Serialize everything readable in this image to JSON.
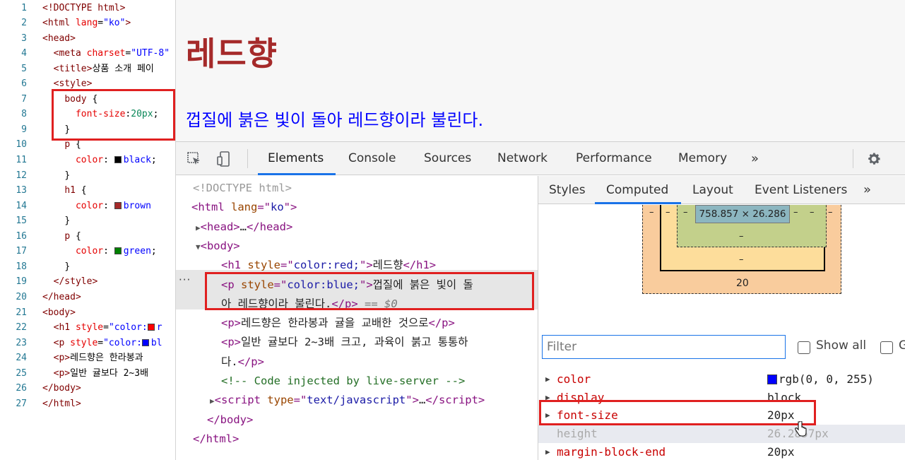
{
  "editor": {
    "lines": [
      {
        "n": "1",
        "html": "<span class='c-tag'>&lt;!DOCTYPE html&gt;</span>"
      },
      {
        "n": "2",
        "html": "<span class='c-tag'>&lt;html </span><span class='c-attr'>lang</span><span class='c-txt'>=</span><span class='c-str'>\"ko\"</span><span class='c-tag'>&gt;</span>"
      },
      {
        "n": "3",
        "html": "<span class='c-tag'>&lt;head&gt;</span>"
      },
      {
        "n": "4",
        "html": "  <span class='c-tag'>&lt;meta </span><span class='c-attr'>charset</span><span class='c-txt'>=</span><span class='c-str'>\"UTF-8\"</span>"
      },
      {
        "n": "5",
        "html": "  <span class='c-tag'>&lt;title&gt;</span><span class='c-txt'>상품 소개 페이</span>"
      },
      {
        "n": "6",
        "html": "  <span class='c-tag'>&lt;style&gt;</span>"
      },
      {
        "n": "7",
        "html": "    <span class='c-sel'>body</span> <span class='c-txt'>{</span>"
      },
      {
        "n": "8",
        "html": "      <span class='c-prop'>font-size</span><span class='c-txt'>:</span><span class='c-num'>20px</span><span class='c-txt'>;</span>"
      },
      {
        "n": "9",
        "html": "    <span class='c-txt'>}</span>"
      },
      {
        "n": "10",
        "html": "    <span class='c-sel'>p</span> <span class='c-txt'>{</span>"
      },
      {
        "n": "11",
        "html": "      <span class='c-prop'>color</span><span class='c-txt'>: </span><span class='swatch' style='background:#000'></span><span class='c-str'>black</span><span class='c-txt'>;</span>"
      },
      {
        "n": "12",
        "html": "    <span class='c-txt'>}</span>"
      },
      {
        "n": "13",
        "html": "    <span class='c-sel'>h1</span> <span class='c-txt'>{</span>"
      },
      {
        "n": "14",
        "html": "      <span class='c-prop'>color</span><span class='c-txt'>: </span><span class='swatch' style='background:#a52a2a'></span><span class='c-str'>brown</span>"
      },
      {
        "n": "15",
        "html": "    <span class='c-txt'>}</span>"
      },
      {
        "n": "16",
        "html": "    <span class='c-sel'>p</span> <span class='c-txt'>{</span>"
      },
      {
        "n": "17",
        "html": "      <span class='c-prop'>color</span><span class='c-txt'>: </span><span class='swatch' style='background:#008000'></span><span class='c-str'>green</span><span class='c-txt'>;</span>"
      },
      {
        "n": "18",
        "html": "    <span class='c-txt'>}</span>"
      },
      {
        "n": "19",
        "html": "  <span class='c-tag'>&lt;/style&gt;</span>"
      },
      {
        "n": "20",
        "html": "<span class='c-tag'>&lt;/head&gt;</span>"
      },
      {
        "n": "21",
        "html": "<span class='c-tag'>&lt;body&gt;</span>"
      },
      {
        "n": "22",
        "html": "  <span class='c-tag'>&lt;h1 </span><span class='c-attr'>style</span><span class='c-txt'>=</span><span class='c-str'>\"color:</span><span class='swatch' style='background:#ff0000'></span><span class='c-str'>r</span>"
      },
      {
        "n": "23",
        "html": "  <span class='c-tag'>&lt;p </span><span class='c-attr'>style</span><span class='c-txt'>=</span><span class='c-str'>\"color:</span><span class='swatch' style='background:#0000ff'></span><span class='c-str'>bl</span>"
      },
      {
        "n": "24",
        "html": "  <span class='c-tag'>&lt;p&gt;</span><span class='c-txt'>레드향은 한라봉과 </span>"
      },
      {
        "n": "25",
        "html": "  <span class='c-tag'>&lt;p&gt;</span><span class='c-txt'>일반 귤보다 2~3배 </span>"
      },
      {
        "n": "26",
        "html": "<span class='c-tag'>&lt;/body&gt;</span>"
      },
      {
        "n": "27",
        "html": "<span class='c-tag'>&lt;/html&gt;</span>"
      }
    ]
  },
  "rendered_page": {
    "h1": "레드향",
    "p": "껍질에 붉은 빛이 돌아 레드향이라 불린다."
  },
  "devtools": {
    "tabs": [
      "Elements",
      "Console",
      "Sources",
      "Network",
      "Performance",
      "Memory"
    ],
    "more_tabs": "»",
    "gear_icon": "gear-icon",
    "dom": [
      {
        "html": "<span class='d-doctype'>&lt;!DOCTYPE html&gt;</span>"
      },
      {
        "html": "<span class='d-tag'>&lt;html </span><span class='d-attr'>lang</span><span class='d-tag'>=\"</span><span class='d-val'>ko</span><span class='d-tag'>\"&gt;</span>"
      },
      {
        "html": "<span class='d-tri'>▶</span><span class='d-tag'>&lt;head&gt;</span><span class='d-text'>…</span><span class='d-tag'>&lt;/head&gt;</span>"
      },
      {
        "html": "<span class='d-tri'>▼</span><span class='d-tag'>&lt;body&gt;</span>"
      },
      {
        "html": "<span class='d-tag'>&lt;h1 </span><span class='d-attr'>style</span><span class='d-tag'>=\"</span><span class='d-val'>color:red;</span><span class='d-tag'>\"&gt;</span><span class='d-text'>레드향</span><span class='d-tag'>&lt;/h1&gt;</span>"
      },
      {
        "html": "<span class='d-tag'>&lt;p </span><span class='d-attr'>style</span><span class='d-tag'>=\"</span><span class='d-val'>color:blue;</span><span class='d-tag'>\"&gt;</span><span class='d-text'>껍질에 붉은 빛이 돌</span>"
      },
      {
        "html": "<span class='d-text'>아 레드향이라 불린다.</span><span class='d-tag'>&lt;/p&gt;</span><span class='d-meta'> == $0</span>"
      },
      {
        "html": "<span class='d-tag'>&lt;p&gt;</span><span class='d-text'>레드향은 한라봉과 귤을 교배한 것으로</span><span class='d-tag'>&lt;/p&gt;</span>"
      },
      {
        "html": "<span class='d-tag'>&lt;p&gt;</span><span class='d-text'>일반 귤보다 2~3배 크고, 과육이 붉고 통통하</span>"
      },
      {
        "html": "<span class='d-text'>다.</span><span class='d-tag'>&lt;/p&gt;</span>"
      },
      {
        "html": "<span class='d-comment'>&lt;!-- Code injected by live-server --&gt;</span>"
      },
      {
        "html": "<span class='d-tri'>▶</span><span class='d-tag'>&lt;script </span><span class='d-attr'>type</span><span class='d-tag'>=\"</span><span class='d-val'>text/javascript</span><span class='d-tag'>\"&gt;</span><span class='d-text'>…</span><span class='d-tag'>&lt;/script&gt;</span>"
      },
      {
        "html": "<span class='d-tag'>&lt;/body&gt;</span>"
      },
      {
        "html": "<span class='d-tag'>&lt;/html&gt;</span>"
      }
    ],
    "dom_dots": "···",
    "sidebar": {
      "tabs": [
        "Styles",
        "Computed",
        "Layout",
        "Event Listeners"
      ],
      "more_tabs": "»",
      "active_tab": "Computed",
      "box_model": {
        "content": "758.857 × 26.286",
        "padding_bottom": "–",
        "border_bottom": "–",
        "margin_bottom": "20",
        "dashes": "–"
      },
      "filter_placeholder": "Filter",
      "show_all": "Show all",
      "group": "G",
      "properties": [
        {
          "name": "color",
          "value": "rgb(0, 0, 255)",
          "swatch": "#0000ff",
          "expandable": true,
          "inherited": false
        },
        {
          "name": "display",
          "value": "block",
          "expandable": true,
          "inherited": false
        },
        {
          "name": "font-size",
          "value": "20px",
          "expandable": true,
          "inherited": false
        },
        {
          "name": "height",
          "value": "26.2857px",
          "expandable": false,
          "inherited": true
        },
        {
          "name": "margin-block-end",
          "value": "20px",
          "expandable": true,
          "inherited": false
        }
      ]
    }
  },
  "colors": {
    "highlight_red": "#e02020",
    "h1_brown": "#a52a2a",
    "p_blue": "#0000ff",
    "accent": "#1a73e8"
  }
}
